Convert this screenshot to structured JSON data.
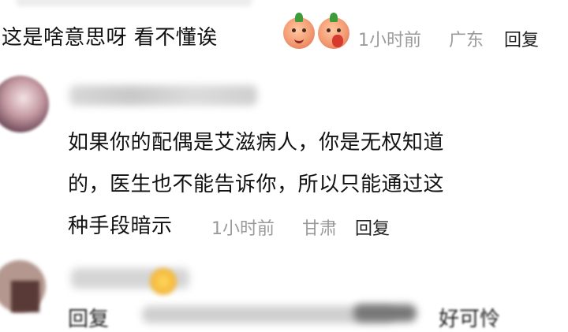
{
  "comments": [
    {
      "text": "这是啥意思呀 看不懂诶",
      "emojis": [
        "tomato-smile-icon",
        "tomato-cover-mouth-icon"
      ],
      "time": "1小时前",
      "location": "广东",
      "reply_label": "回复"
    },
    {
      "text_lines": [
        "如果你的配偶是艾滋病人，你是无权知道",
        "的，医生也不能告诉你，所以只能通过这",
        "种手段暗示"
      ],
      "time": "1小时前",
      "location": "甘肃",
      "reply_label": "回复"
    },
    {
      "text_start": "回复",
      "text_end": "好可怜"
    }
  ]
}
